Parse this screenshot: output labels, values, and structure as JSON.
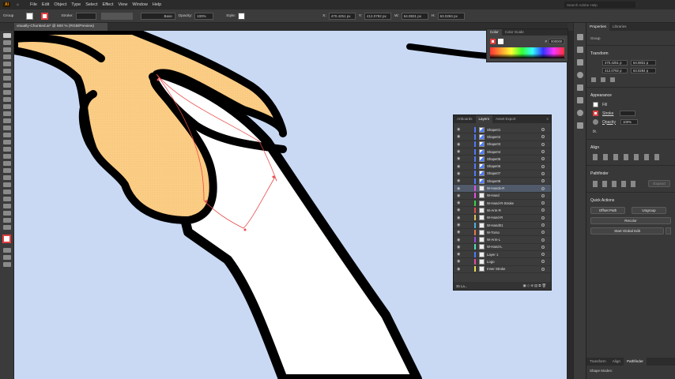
{
  "menubar": {
    "logo": "Ai",
    "items": [
      "File",
      "Edit",
      "Object",
      "Type",
      "Select",
      "Effect",
      "View",
      "Window",
      "Help"
    ],
    "search_placeholder": "Search Adobe Help"
  },
  "control": {
    "selection": "Group",
    "stroke_label": "Stroke:",
    "stroke_value": "",
    "stroke_style": "Basic",
    "opacity_label": "Opacity:",
    "opacity_value": "100%",
    "style_label": "Style:",
    "x_label": "X:",
    "x_value": "470.4251 px",
    "y_label": "Y:",
    "y_value": "412.0792 px",
    "w_label": "W:",
    "w_value": "64.0831 px",
    "h_label": "H:",
    "h_value": "63.0284 px"
  },
  "document": {
    "tab_title": "visually-Chunked.ai* @ 600 % (RGB/Preview)"
  },
  "color_panel": {
    "tabs": [
      "Color",
      "Color Guide"
    ],
    "hex_label": "#",
    "hex_value": "000000"
  },
  "layers_panel": {
    "tabs": [
      "Artboards",
      "Layers",
      "Asset Export"
    ],
    "footer_count": "35 La...",
    "rows": [
      {
        "name": "Shape01",
        "color": "#4e7cf5"
      },
      {
        "name": "Shape02",
        "color": "#4e7cf5"
      },
      {
        "name": "Shape03",
        "color": "#4e7cf5"
      },
      {
        "name": "Shape04",
        "color": "#4e7cf5"
      },
      {
        "name": "Shape05",
        "color": "#4e7cf5"
      },
      {
        "name": "Shape06",
        "color": "#4e7cf5"
      },
      {
        "name": "Shape07",
        "color": "#4e7cf5"
      },
      {
        "name": "Shape08",
        "color": "#4e7cf5"
      },
      {
        "name": "W-Hands-R",
        "color": "#e04fe0",
        "selected": true
      },
      {
        "name": "W-Hand",
        "color": "#e04fe0"
      },
      {
        "name": "W-Hand-R-Stroke",
        "color": "#3ad04a"
      },
      {
        "name": "W-Arm-R",
        "color": "#e04f4f"
      },
      {
        "name": "W-Hand-R",
        "color": "#e0c24f"
      },
      {
        "name": "W-Hand01",
        "color": "#4fb0e0"
      },
      {
        "name": "W-Torso",
        "color": "#e07a4f"
      },
      {
        "name": "W-Arm-L",
        "color": "#9b4fe0"
      },
      {
        "name": "W-Hand-L",
        "color": "#4fe0b5"
      },
      {
        "name": "Layer 1",
        "color": "#4e7cf5"
      },
      {
        "name": "Logo",
        "color": "#e04f9b"
      },
      {
        "name": "Inner Stroke",
        "color": "#e0e04f"
      }
    ]
  },
  "properties": {
    "tabs": [
      "Properties",
      "Libraries"
    ],
    "selection": "Group",
    "transform_title": "Transform",
    "x": "470.4251 p",
    "y": "412.0792 p",
    "w": "64.0831 p",
    "h": "63.0284 p",
    "appearance_title": "Appearance",
    "fill_label": "Fill",
    "stroke_label": "Stroke",
    "opacity_label": "Opacity",
    "opacity_value": "100%",
    "fx_label": "fx.",
    "align_title": "Align",
    "pathfinder_title": "Pathfinder",
    "expand_label": "Expand",
    "quick_actions_title": "Quick Actions",
    "offset_label": "Offset Path",
    "ungroup_label": "Ungroup",
    "recolor_label": "Recolor",
    "global_edit_label": "Start Global Edit",
    "bottom_tabs": [
      "Transform",
      "Align",
      "Pathfinder"
    ],
    "shape_modes": "Shape Modes:"
  },
  "colors": {
    "canvas_bg": "#c9d9f4",
    "skin_orange": "#fccd84",
    "outline": "#000000",
    "selection": "#e84b4b"
  }
}
